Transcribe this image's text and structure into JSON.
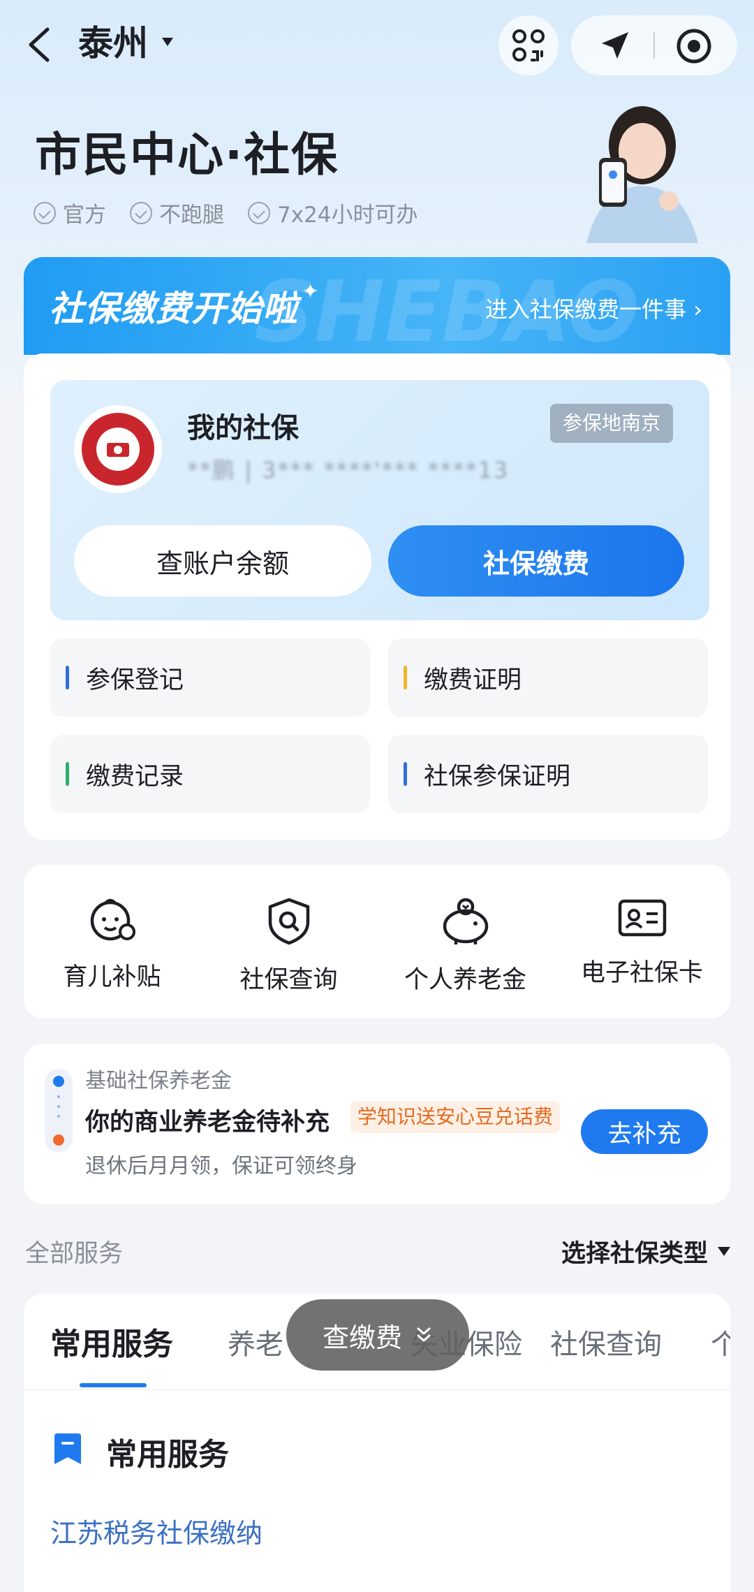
{
  "header": {
    "city": "泰州",
    "title": "市民中心·社保",
    "tags": [
      "官方",
      "不跑腿",
      "7x24小时可办"
    ]
  },
  "banner": {
    "title": "社保缴费开始啦",
    "watermark": "SHEBAO",
    "link": "进入社保缴费一件事 ›"
  },
  "social_card": {
    "title": "我的社保",
    "number_masked": "**鹏 | 3*** ****'*** ****13",
    "badge": "参保地南京",
    "balance_button": "查账户余额",
    "pay_button": "社保缴费"
  },
  "quick_links": [
    {
      "label": "参保登记",
      "color": "#2f6fd6"
    },
    {
      "label": "缴费证明",
      "color": "#f0b429"
    },
    {
      "label": "缴费记录",
      "color": "#2fae6b"
    },
    {
      "label": "社保参保证明",
      "color": "#2f6fd6"
    }
  ],
  "icon_services": [
    {
      "label": "育儿补贴",
      "icon": "baby-icon"
    },
    {
      "label": "社保查询",
      "icon": "shield-search-icon"
    },
    {
      "label": "个人养老金",
      "icon": "piggy-bank-icon"
    },
    {
      "label": "电子社保卡",
      "icon": "id-card-icon"
    }
  ],
  "pension": {
    "subtitle": "基础社保养老金",
    "title": "你的商业养老金待补充",
    "tag": "学知识送安心豆兑话费",
    "desc": "退休后月月领，保证可领终身",
    "button": "去补充"
  },
  "services_header": {
    "all": "全部服务",
    "select": "选择社保类型"
  },
  "tabs": [
    "常用服务",
    "养老",
    "失业保险",
    "社保查询",
    "个"
  ],
  "section": {
    "title": "常用服务",
    "items": [
      "江苏税务社保缴纳"
    ]
  },
  "float_pill": {
    "label": "查缴费"
  },
  "colors": {
    "accent": "#1f7af0",
    "banner": "#2aa0f3",
    "orange": "#e46a1f"
  }
}
